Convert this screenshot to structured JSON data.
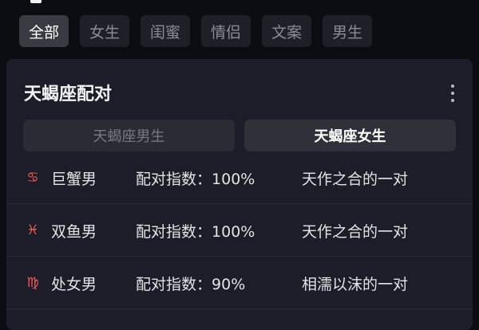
{
  "filter_tabs": [
    "全部",
    "女生",
    "闺蜜",
    "情侣",
    "文案",
    "男生"
  ],
  "active_tab": 0,
  "card": {
    "title": "天蝎座配对",
    "segments": [
      "天蝎座男生",
      "天蝎座女生"
    ],
    "active_segment": 1,
    "score_label": "配对指数：",
    "rows": [
      {
        "icon": "cancer-sign-icon",
        "glyph": "♋",
        "name": "巨蟹男",
        "score": "100%",
        "desc": "天作之合的一对"
      },
      {
        "icon": "pisces-sign-icon",
        "glyph": "♓",
        "name": "双鱼男",
        "score": "100%",
        "desc": "天作之合的一对"
      },
      {
        "icon": "virgo-sign-icon",
        "glyph": "♍",
        "name": "处女男",
        "score": "90%",
        "desc": "相濡以沫的一对"
      }
    ]
  },
  "colors": {
    "accent": "#ff5a55",
    "card_bg": "#1c1d28",
    "page_bg": "#0c0d12"
  }
}
